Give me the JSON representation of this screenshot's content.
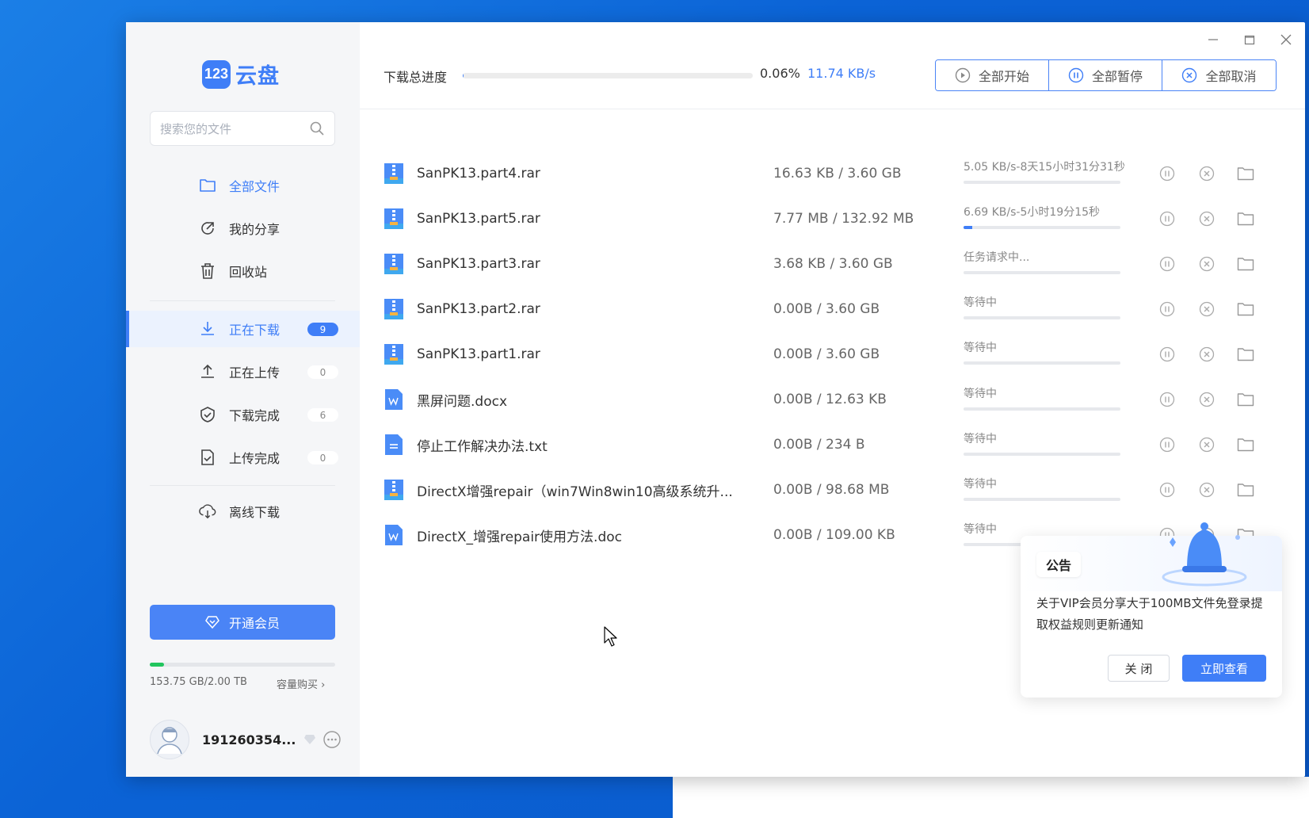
{
  "app": {
    "logo_badge": "123",
    "logo_text": "云盘"
  },
  "sidebar": {
    "search_placeholder": "搜索您的文件",
    "items": [
      {
        "label": "全部文件",
        "icon": "folder-icon"
      },
      {
        "label": "我的分享",
        "icon": "share-icon"
      },
      {
        "label": "回收站",
        "icon": "trash-icon"
      },
      {
        "label": "正在下载",
        "icon": "download-icon",
        "badge": "9"
      },
      {
        "label": "正在上传",
        "icon": "upload-icon",
        "badge": "0"
      },
      {
        "label": "下载完成",
        "icon": "check-circle-icon",
        "badge": "6"
      },
      {
        "label": "上传完成",
        "icon": "file-check-icon",
        "badge": "0"
      },
      {
        "label": "离线下载",
        "icon": "cloud-download-icon"
      }
    ],
    "vip_button": "开通会员",
    "storage_text": "153.75 GB/2.00 TB",
    "storage_fraction": 0.075,
    "storage_buy": "容量购买",
    "username": "191260354..."
  },
  "topbar": {
    "progress_label": "下载总进度",
    "progress_percent": "0.06%",
    "progress_fraction": 0.0006,
    "speed": "11.74 KB/s",
    "start_all": "全部开始",
    "pause_all": "全部暂停",
    "cancel_all": "全部取消"
  },
  "downloads": [
    {
      "name": "SanPK13.part4.rar",
      "size": "16.63 KB / 3.60 GB",
      "status": "5.05 KB/s-8天15小时31分31秒",
      "progress": 0.0,
      "type": "rar"
    },
    {
      "name": "SanPK13.part5.rar",
      "size": "7.77 MB / 132.92 MB",
      "status": "6.69 KB/s-5小时19分15秒",
      "progress": 0.058,
      "type": "rar"
    },
    {
      "name": "SanPK13.part3.rar",
      "size": "3.68 KB / 3.60 GB",
      "status": "任务请求中...",
      "progress": 0.0,
      "type": "rar"
    },
    {
      "name": "SanPK13.part2.rar",
      "size": "0.00B / 3.60 GB",
      "status": "等待中",
      "progress": 0.0,
      "type": "rar"
    },
    {
      "name": "SanPK13.part1.rar",
      "size": "0.00B / 3.60 GB",
      "status": "等待中",
      "progress": 0.0,
      "type": "rar"
    },
    {
      "name": "黑屏问题.docx",
      "size": "0.00B / 12.63 KB",
      "status": "等待中",
      "progress": 0.0,
      "type": "doc"
    },
    {
      "name": "停止工作解决办法.txt",
      "size": "0.00B / 234 B",
      "status": "等待中",
      "progress": 0.0,
      "type": "txt"
    },
    {
      "name": "DirectX增强repair（win7Win8win10高级系统升...",
      "size": "0.00B / 98.68 MB",
      "status": "等待中",
      "progress": 0.0,
      "type": "rar"
    },
    {
      "name": "DirectX_增强repair使用方法.doc",
      "size": "0.00B / 109.00 KB",
      "status": "等待中",
      "progress": 0.0,
      "type": "doc"
    }
  ],
  "notice": {
    "tag": "公告",
    "text": "关于VIP会员分享大于100MB文件免登录提取权益规则更新通知",
    "close": "关 闭",
    "view": "立即查看"
  },
  "colors": {
    "accent": "#3f7ef7",
    "desktop": "#0b63d6",
    "storage": "#22c55e"
  }
}
